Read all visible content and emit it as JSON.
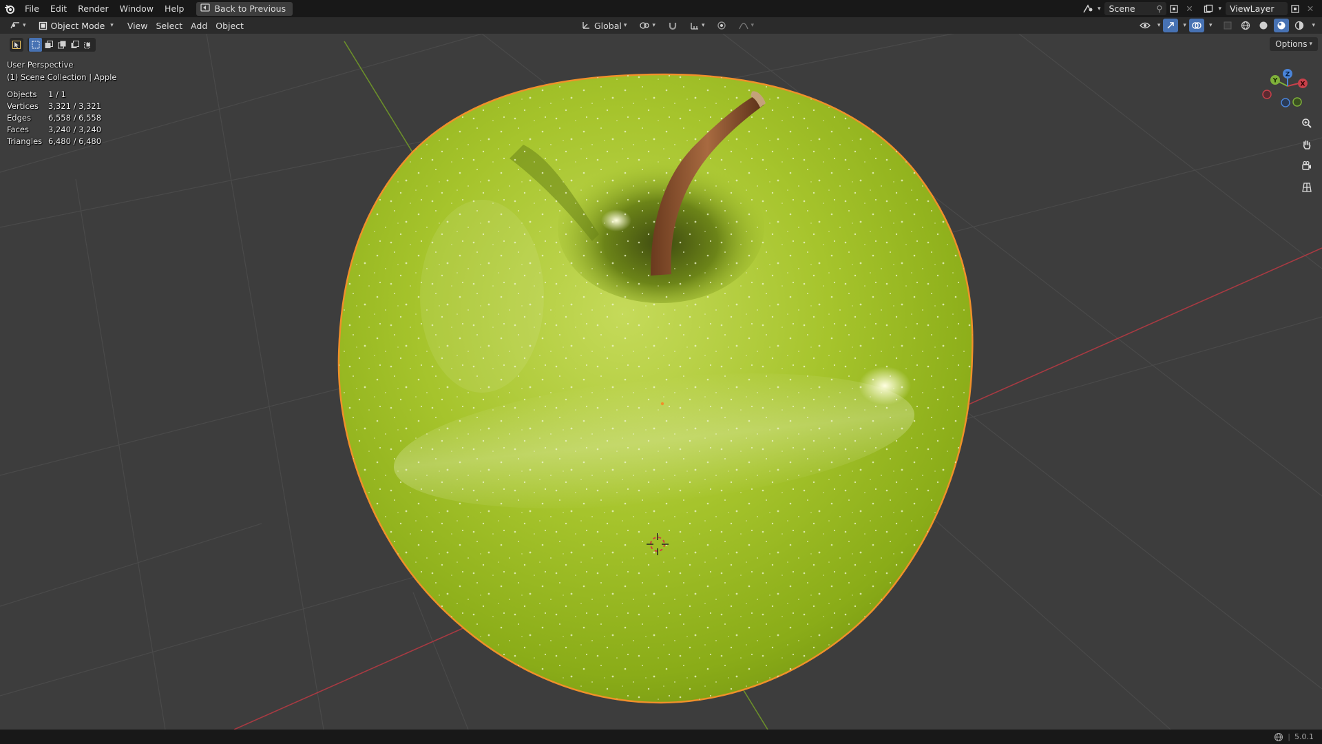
{
  "menubar": {
    "items": [
      "File",
      "Edit",
      "Render",
      "Window",
      "Help"
    ],
    "back_button": "Back to Previous",
    "scene_name": "Scene",
    "view_layer_name": "ViewLayer"
  },
  "header": {
    "mode": "Object Mode",
    "menus": [
      "View",
      "Select",
      "Add",
      "Object"
    ],
    "transform_orientation": "Global"
  },
  "viewport": {
    "perspective_label": "User Perspective",
    "collection_label": "(1) Scene Collection | Apple",
    "options_label": "Options",
    "stats": [
      {
        "label": "Objects",
        "value": "1 / 1"
      },
      {
        "label": "Vertices",
        "value": "3,321 / 3,321"
      },
      {
        "label": "Edges",
        "value": "6,558 / 6,558"
      },
      {
        "label": "Faces",
        "value": "3,240 / 3,240"
      },
      {
        "label": "Triangles",
        "value": "6,480 / 6,480"
      }
    ],
    "gizmo_axes": [
      "X",
      "Y",
      "Z"
    ],
    "colors": {
      "x_axis": "#c8404a",
      "y_axis": "#7fb13a",
      "z_axis": "#4a84d9",
      "selection_outline": "#f0902a",
      "apple_main": "#9bc22a"
    }
  },
  "statusbar": {
    "version": "5.0.1"
  }
}
